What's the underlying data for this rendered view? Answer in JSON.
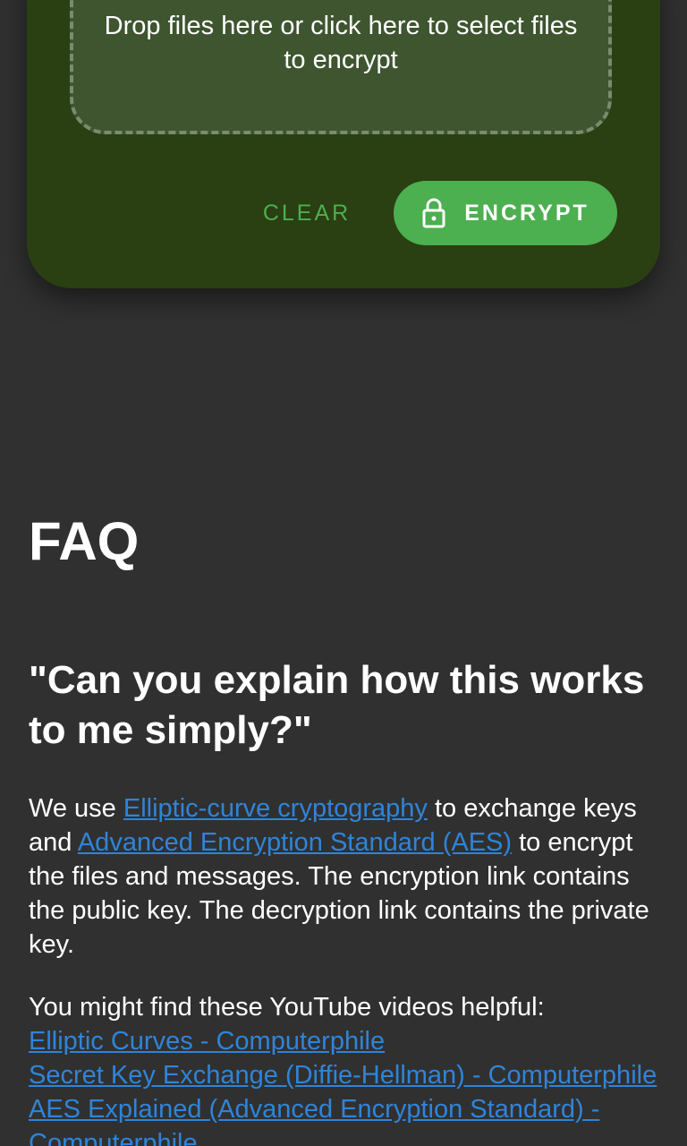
{
  "upload": {
    "dropzone_text": "Drop files here or click here to select files to encrypt",
    "clear_label": "CLEAR",
    "encrypt_label": "ENCRYPT",
    "encrypt_icon": "lock-icon"
  },
  "faq": {
    "title": "FAQ",
    "question": "\"Can you explain how this works to me simply?\"",
    "answer": {
      "part1": "We use ",
      "link1": "Elliptic-curve cryptography",
      "part2": " to exchange keys and ",
      "link2": "Advanced Encryption Standard (AES)",
      "part3": " to encrypt the files and messages. The encryption link contains the public key. The decryption link contains the private key."
    },
    "videos_intro": "You might find these YouTube videos helpful:",
    "videos": [
      "Elliptic Curves - Computerphile",
      "Secret Key Exchange (Diffie-Hellman) - Computerphile",
      "AES Explained (Advanced Encryption Standard) - Computerphile"
    ]
  },
  "colors": {
    "background": "#303030",
    "card": "#2a3f12",
    "accent": "#4caf50",
    "link": "#2f84d8"
  }
}
